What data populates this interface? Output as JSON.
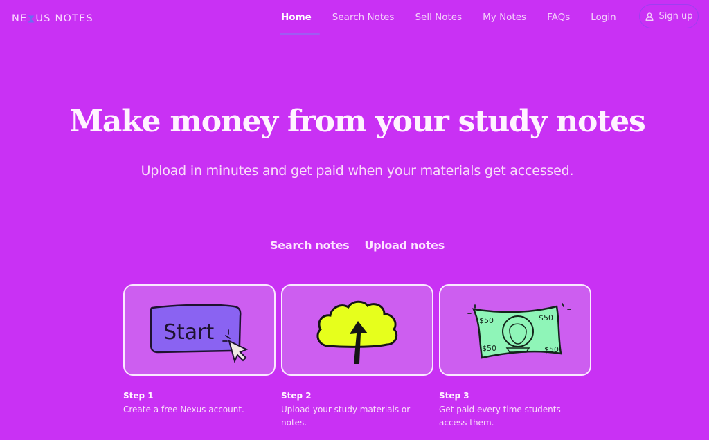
{
  "brand": {
    "prefix": "NE",
    "suffix": "US NOTES",
    "x_icon": "hourglass-x-icon"
  },
  "nav": {
    "items": [
      {
        "label": "Home",
        "active": true
      },
      {
        "label": "Search Notes",
        "active": false
      },
      {
        "label": "Sell Notes",
        "active": false
      },
      {
        "label": "My Notes",
        "active": false
      },
      {
        "label": "FAQs",
        "active": false
      },
      {
        "label": "Login",
        "active": false
      }
    ],
    "signup": {
      "label": "Sign up",
      "icon": "user-icon"
    }
  },
  "hero": {
    "title": "Make money from your study notes",
    "subtitle": "Upload in minutes and get paid when your materials get accessed."
  },
  "ctas": {
    "search": "Search notes",
    "upload": "Upload notes"
  },
  "steps": [
    {
      "title": "Step 1",
      "description": "Create a free Nexus account.",
      "illustration": "start-button-illustration",
      "illustration_text": "Start"
    },
    {
      "title": "Step 2",
      "description": "Upload your study materials or notes.",
      "illustration": "upload-cloud-illustration"
    },
    {
      "title": "Step 3",
      "description": "Get paid every time students access them.",
      "illustration": "fifty-dollar-bill-illustration",
      "illustration_text": "$50"
    }
  ],
  "colors": {
    "background": "#c931f4",
    "card_bg": "#cd5ef0",
    "start_button": "#8a63f2",
    "cloud": "#e6ff1c",
    "bill": "#8ff5b8",
    "nav_underline": "#8e6cf1"
  }
}
